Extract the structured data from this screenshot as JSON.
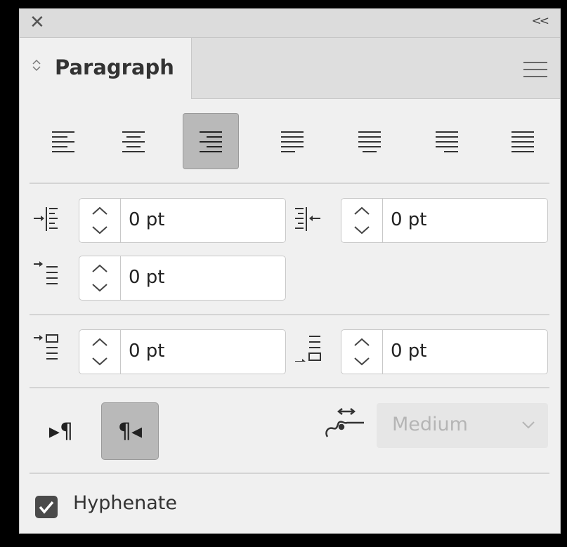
{
  "panel": {
    "close_symbol": "✕",
    "collapse_symbol": "<<",
    "tab_title": "Paragraph"
  },
  "alignment": {
    "buttons": [
      "align-left",
      "align-center",
      "align-right",
      "justify-last-left",
      "justify-last-center",
      "justify-last-right",
      "justify-all"
    ],
    "selected": "align-right"
  },
  "indents": {
    "left_indent": "0 pt",
    "right_indent": "0 pt",
    "first_line_indent": "0 pt"
  },
  "spacing": {
    "space_before": "0 pt",
    "space_after": "0 pt"
  },
  "direction": {
    "ltr_label": "▸¶",
    "rtl_label": "¶◂",
    "selected": "rtl"
  },
  "kashida": {
    "value": "Medium",
    "icon": "kashida-icon"
  },
  "hyphenate": {
    "label": "Hyphenate",
    "checked": true
  },
  "colors": {
    "panel_bg": "#f0f0f0",
    "selected_bg": "#b9b9b9",
    "checkbox": "#4a4a4a"
  }
}
